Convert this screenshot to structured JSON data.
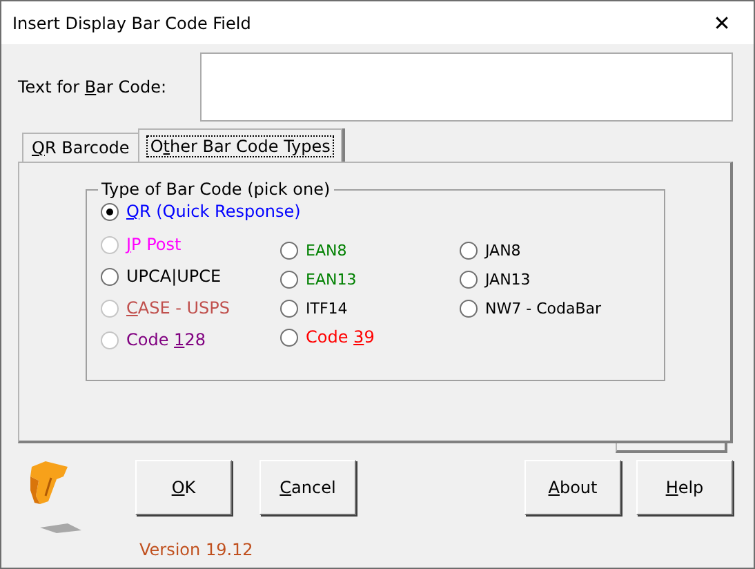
{
  "window": {
    "title": "Insert Display Bar Code Field",
    "close": "✕"
  },
  "text_field": {
    "label": {
      "pre": "Text for ",
      "key": "B",
      "post": "ar Code:"
    }
  },
  "tabs": [
    {
      "label": {
        "key": "Q",
        "post": "R Barcode"
      },
      "selected": false
    },
    {
      "label": {
        "pre": "O",
        "key": "t",
        "post": "her Bar Code Types"
      },
      "selected": true
    }
  ],
  "group": {
    "title": "Type of Bar Code (pick one)",
    "top_option": {
      "label": {
        "key": "Q",
        "post": "R (Quick Response)"
      },
      "color": "#0000ff",
      "selected": true,
      "disabled": false
    },
    "columns": [
      [
        {
          "label": {
            "key": "J",
            "post": "P Post"
          },
          "color": "#ff00ff",
          "selected": false,
          "disabled": true
        },
        {
          "label": {
            "post": "UPCA|UPCE"
          },
          "color": "#000000",
          "selected": false,
          "disabled": false
        },
        {
          "label": {
            "key": "C",
            "post": "ASE - USPS"
          },
          "color": "#c0504d",
          "selected": false,
          "disabled": true
        },
        {
          "label": {
            "pre": "Code ",
            "key": "1",
            "post": "28"
          },
          "color": "#800080",
          "selected": false,
          "disabled": true
        }
      ],
      [
        {
          "label": {
            "post": "EAN8"
          },
          "color": "#008000",
          "selected": false,
          "disabled": false
        },
        {
          "label": {
            "post": "EAN13"
          },
          "color": "#008000",
          "selected": false,
          "disabled": false
        },
        {
          "label": {
            "post": "ITF14"
          },
          "color": "#000000",
          "selected": false,
          "disabled": false
        },
        {
          "label": {
            "pre": "Code ",
            "key": "3",
            "post": "9"
          },
          "color": "#ff0000",
          "selected": false,
          "disabled": false
        }
      ],
      [
        {
          "label": {
            "post": "JAN8"
          },
          "color": "#000000",
          "selected": false,
          "disabled": false
        },
        {
          "label": {
            "post": "JAN13"
          },
          "color": "#000000",
          "selected": false,
          "disabled": false
        },
        {
          "label": {
            "post": "NW7 - CodaBar"
          },
          "color": "#000000",
          "selected": false,
          "disabled": false
        }
      ]
    ]
  },
  "buttons_left": [
    {
      "label": {
        "key": "O",
        "post": "K"
      }
    },
    {
      "label": {
        "key": "C",
        "post": "ancel"
      }
    }
  ],
  "buttons_right": [
    {
      "label": {
        "key": "A",
        "post": "bout"
      }
    },
    {
      "label": {
        "key": "H",
        "post": "elp"
      }
    }
  ],
  "version": "Version 19.12"
}
